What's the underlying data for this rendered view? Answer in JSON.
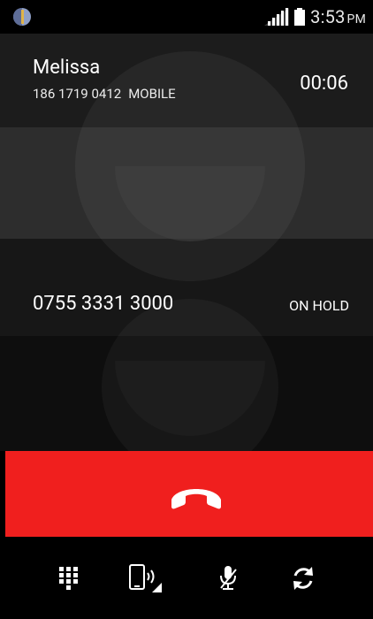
{
  "status_bar": {
    "time": "3:53",
    "ampm": "PM",
    "icons": [
      "app-notification-icon",
      "signal-icon",
      "battery-icon"
    ]
  },
  "active_call": {
    "name": "Melissa",
    "number": "186 1719 0412",
    "label": "MOBILE",
    "duration": "00:06"
  },
  "held_call": {
    "number": "0755 3331 3000",
    "status": "ON HOLD"
  },
  "end_call": {
    "icon": "end-call-icon",
    "color": "#f01f1e"
  },
  "controls": [
    {
      "name": "dialpad-icon"
    },
    {
      "name": "audio-route-icon"
    },
    {
      "name": "mute-icon"
    },
    {
      "name": "swap-calls-icon"
    }
  ]
}
